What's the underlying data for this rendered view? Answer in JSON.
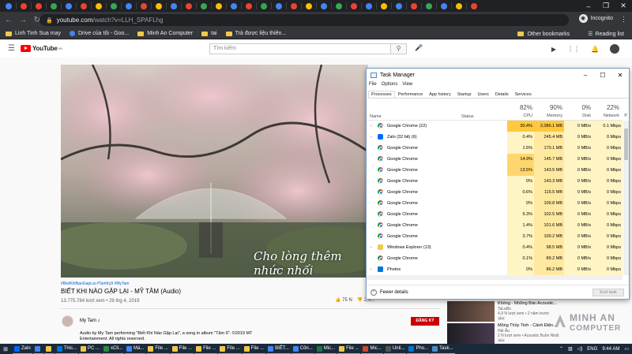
{
  "browser": {
    "url_host": "youtube.com",
    "url_path": "/watch?v=LLH_SPAFLhg",
    "profile": "Incognito",
    "tab_favicon_colors": [
      "#4285f4",
      "#ea4335",
      "#ea4335",
      "#34a853",
      "#4285f4",
      "#ea4335",
      "#fbbc05",
      "#34a853",
      "#4285f4",
      "#ea4335",
      "#fbbc05",
      "#4285f4",
      "#ea4335",
      "#34a853",
      "#fbbc05",
      "#4285f4",
      "#ea4335",
      "#34a853",
      "#4285f4",
      "#ea4335",
      "#fbbc05",
      "#4285f4",
      "#34a853",
      "#ea4335",
      "#4285f4",
      "#fbbc05",
      "#4285f4",
      "#ea4335",
      "#34a853",
      "#4285f4",
      "#fbbc05",
      "#ea4335"
    ]
  },
  "bookmarks": {
    "items": [
      "Linh Tinh Sua may",
      "Drive của tôi - Goo...",
      "Minh An Computer",
      "tai",
      "Trả được liệu thiên..."
    ],
    "other": "Other bookmarks",
    "reading": "Reading list"
  },
  "youtube": {
    "logo": "YouTube",
    "logo_country": "VN",
    "search_placeholder": "Tìm kiếm",
    "video": {
      "caption": "Cho lòng thêm nhức nhối",
      "hashtags": "#BietKhiNaoGapLai #TamKy9 #MyTam",
      "title": "BIẾT KHI NÀO GẶP LẠI - MỸ TÂM (Audio)",
      "meta": "13.775.784 lượt xem • 29 thg 4, 2019",
      "likes": "75 N",
      "dislikes": "2,4..."
    },
    "channel": {
      "name": "My Tam ♪",
      "subscribe": "ĐĂNG KÝ",
      "description_line1": "Audio by My Tam performing \"Biết Khi Nào Gặp Lại\", a song in album \"Tâm 9\". ©2019 MT",
      "description_line2": "Entertainment. All rights reserved."
    },
    "recommendations": [
      {
        "title": "Không - Những Bản Acoustic...",
        "channel": "TaLaBo",
        "views": "4,9 N lượt xem • 2 năm trước",
        "badge": "Mới"
      },
      {
        "title": "Mộng Thủy Tinh - Cảnh Điện...",
        "channel": "Hải Âu",
        "views": "2 N lượt xem • Acoustic Buồn Nhất",
        "badge": "Mới"
      }
    ]
  },
  "watermark": {
    "line1": "MINH AN",
    "line2": "COMPUTER"
  },
  "task_manager": {
    "title": "Task Manager",
    "menu": [
      "File",
      "Options",
      "View"
    ],
    "tabs": [
      "Processes",
      "Performance",
      "App history",
      "Startup",
      "Users",
      "Details",
      "Services"
    ],
    "columns": {
      "name": "Name",
      "status": "Status",
      "cpu_pct": "82%",
      "cpu": "CPU",
      "mem_pct": "90%",
      "memory": "Memory",
      "disk_pct": "0%",
      "disk": "Disk",
      "net_pct": "22%",
      "network": "Network",
      "power": "P"
    },
    "rows": [
      {
        "name": "Google Chrome (22)",
        "icon": "chrome",
        "expandable": true,
        "cpu": "30.4%",
        "memory": "2,086.1 MB",
        "disk": "0 MB/s",
        "network": "0.1 Mbps"
      },
      {
        "name": "Zalo (32 bit) (6)",
        "icon": "zalo",
        "expandable": true,
        "cpu": "0.4%",
        "memory": "245.4 MB",
        "disk": "0 MB/s",
        "network": "0 Mbps"
      },
      {
        "name": "Google Chrome",
        "icon": "chrome",
        "expandable": false,
        "cpu": "1.5%",
        "memory": "170.1 MB",
        "disk": "0 MB/s",
        "network": "0 Mbps"
      },
      {
        "name": "Google Chrome",
        "icon": "chrome",
        "expandable": false,
        "cpu": "14.9%",
        "memory": "145.7 MB",
        "disk": "0 MB/s",
        "network": "0 Mbps"
      },
      {
        "name": "Google Chrome",
        "icon": "chrome",
        "expandable": false,
        "cpu": "13.5%",
        "memory": "143.5 MB",
        "disk": "0 MB/s",
        "network": "0 Mbps"
      },
      {
        "name": "Google Chrome",
        "icon": "chrome",
        "expandable": false,
        "cpu": "0%",
        "memory": "143.3 MB",
        "disk": "0 MB/s",
        "network": "0 Mbps"
      },
      {
        "name": "Google Chrome",
        "icon": "chrome",
        "expandable": false,
        "cpu": "0.6%",
        "memory": "115.5 MB",
        "disk": "0 MB/s",
        "network": "0 Mbps"
      },
      {
        "name": "Google Chrome",
        "icon": "chrome",
        "expandable": false,
        "cpu": "0%",
        "memory": "109.8 MB",
        "disk": "0 MB/s",
        "network": "0 Mbps"
      },
      {
        "name": "Google Chrome",
        "icon": "chrome",
        "expandable": false,
        "cpu": "5.3%",
        "memory": "102.5 MB",
        "disk": "0 MB/s",
        "network": "0 Mbps"
      },
      {
        "name": "Google Chrome",
        "icon": "chrome",
        "expandable": false,
        "cpu": "1.4%",
        "memory": "101.6 MB",
        "disk": "0 MB/s",
        "network": "0 Mbps"
      },
      {
        "name": "Google Chrome",
        "icon": "chrome",
        "expandable": false,
        "cpu": "3.7%",
        "memory": "100.2 MB",
        "disk": "0 MB/s",
        "network": "0 Mbps"
      },
      {
        "name": "Windows Explorer (13)",
        "icon": "explorer",
        "expandable": true,
        "cpu": "0.4%",
        "memory": "98.5 MB",
        "disk": "0 MB/s",
        "network": "0 Mbps"
      },
      {
        "name": "Google Chrome",
        "icon": "chrome",
        "expandable": false,
        "cpu": "0.1%",
        "memory": "89.2 MB",
        "disk": "0 MB/s",
        "network": "0 Mbps"
      },
      {
        "name": "Photos",
        "icon": "photos",
        "expandable": true,
        "cpu": "0%",
        "memory": "86.2 MB",
        "disk": "0 MB/s",
        "network": "0 Mbps"
      }
    ],
    "fewer_details": "Fewer details",
    "end_task": "End task"
  },
  "taskbar": {
    "items": [
      {
        "label": "Zalo",
        "color": "#0068ff"
      },
      {
        "label": "",
        "color": "#4285f4"
      },
      {
        "label": "",
        "color": "#f2c94c"
      },
      {
        "label": "This...",
        "color": "#0078d7"
      },
      {
        "label": "PC ...",
        "color": "#f2c94c"
      },
      {
        "label": "xCli...",
        "color": "#2d8c3c"
      },
      {
        "label": "Má...",
        "color": "#4285f4"
      },
      {
        "label": "File ...",
        "color": "#f2c94c"
      },
      {
        "label": "File ...",
        "color": "#f2c94c"
      },
      {
        "label": "File ...",
        "color": "#f2c94c"
      },
      {
        "label": "File ...",
        "color": "#f2c94c"
      },
      {
        "label": "File ...",
        "color": "#f2c94c"
      },
      {
        "label": "BIẾT...",
        "color": "#4285f4"
      },
      {
        "label": "Côn...",
        "color": "#4285f4"
      },
      {
        "label": "Mic...",
        "color": "#217346"
      },
      {
        "label": "File ...",
        "color": "#f2c94c"
      },
      {
        "label": "Mic...",
        "color": "#d24726"
      },
      {
        "label": "Unti...",
        "color": "#555555"
      },
      {
        "label": "Pho...",
        "color": "#0078d7"
      },
      {
        "label": "Task...",
        "color": "#4c8cc5"
      }
    ],
    "lang": "ENG",
    "time": "9:44 AM"
  }
}
